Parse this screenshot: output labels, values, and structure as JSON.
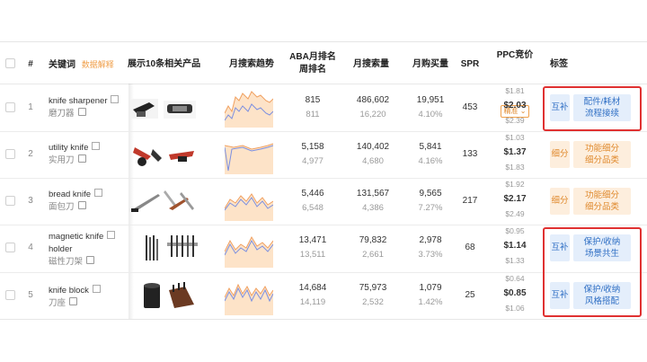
{
  "header": {
    "index": "#",
    "keyword": "关键词",
    "keyword_explain": "数据解释",
    "products": "展示10条相关产品",
    "trend": "月搜索趋势",
    "aba_line1": "ABA月排名",
    "aba_line2": "周排名",
    "search_volume": "月搜索量",
    "purchase": "月购买量",
    "spr": "SPR",
    "ppc": "PPC竞价",
    "ppc_mode": "精准",
    "tags": "标签"
  },
  "rows": [
    {
      "index": "1",
      "keyword": "knife sharpener",
      "translation": "磨刀器",
      "aba_month": "815",
      "aba_week": "811",
      "volume": "486,602",
      "volume_sub": "16,220",
      "purchase": "19,951",
      "purchase_rate": "4.10%",
      "spr": "453",
      "ppc_high": "$1.81",
      "ppc_mid": "$2.03",
      "ppc_low": "$2.39",
      "tag_type": "互补",
      "tag_text_1": "配件/耗材",
      "tag_text_2": "流程接续",
      "tag_color": "blue"
    },
    {
      "index": "2",
      "keyword": "utility knife",
      "translation": "实用刀",
      "aba_month": "5,158",
      "aba_week": "4,977",
      "volume": "140,402",
      "volume_sub": "4,680",
      "purchase": "5,841",
      "purchase_rate": "4.16%",
      "spr": "133",
      "ppc_high": "$1.03",
      "ppc_mid": "$1.37",
      "ppc_low": "$1.83",
      "tag_type": "细分",
      "tag_text_1": "功能细分",
      "tag_text_2": "细分品类",
      "tag_color": "orange"
    },
    {
      "index": "3",
      "keyword": "bread knife",
      "translation": "面包刀",
      "aba_month": "5,446",
      "aba_week": "6,548",
      "volume": "131,567",
      "volume_sub": "4,386",
      "purchase": "9,565",
      "purchase_rate": "7.27%",
      "spr": "217",
      "ppc_high": "$1.92",
      "ppc_mid": "$2.17",
      "ppc_low": "$2.49",
      "tag_type": "细分",
      "tag_text_1": "功能细分",
      "tag_text_2": "细分品类",
      "tag_color": "orange"
    },
    {
      "index": "4",
      "keyword": "magnetic knife",
      "keyword_line2": "holder",
      "translation": "磁性刀架",
      "aba_month": "13,471",
      "aba_week": "13,511",
      "volume": "79,832",
      "volume_sub": "2,661",
      "purchase": "2,978",
      "purchase_rate": "3.73%",
      "spr": "68",
      "ppc_high": "$0.95",
      "ppc_mid": "$1.14",
      "ppc_low": "$1.33",
      "tag_type": "互补",
      "tag_text_1": "保护/收纳",
      "tag_text_2": "场景共生",
      "tag_color": "blue"
    },
    {
      "index": "5",
      "keyword": "knife block",
      "translation": "刀座",
      "aba_month": "14,684",
      "aba_week": "14,119",
      "volume": "75,973",
      "volume_sub": "2,532",
      "purchase": "1,079",
      "purchase_rate": "1.42%",
      "spr": "25",
      "ppc_high": "$0.64",
      "ppc_mid": "$0.85",
      "ppc_low": "$1.06",
      "tag_type": "互补",
      "tag_text_1": "保护/收纳",
      "tag_text_2": "风格搭配",
      "tag_color": "blue"
    }
  ],
  "colors": {
    "accent_orange": "#f0a04b",
    "accent_blue": "#2f6fc4",
    "highlight_red": "#e03131",
    "trend_fill": "#fde3c8",
    "trend_line_orange": "#f0a060",
    "trend_line_blue": "#7b8fe0"
  }
}
